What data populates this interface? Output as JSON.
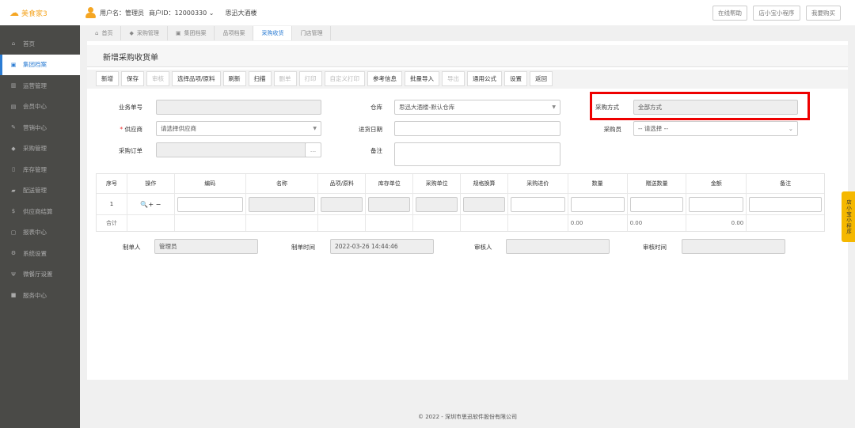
{
  "app": {
    "logo": "美食家3",
    "user_label": "用户名：管理员",
    "merchant_label": "商户ID：12000330",
    "store": "思迅大酒楼"
  },
  "top_buttons": [
    "在线帮助",
    "店小宝小程序",
    "我要购买"
  ],
  "sidebar": {
    "items": [
      {
        "label": "首页",
        "icon": "home-icon",
        "glyph": "⌂"
      },
      {
        "label": "集团档案",
        "icon": "file-icon",
        "glyph": "▣"
      },
      {
        "label": "运营管理",
        "icon": "chart-icon",
        "glyph": "▥"
      },
      {
        "label": "会员中心",
        "icon": "card-icon",
        "glyph": "▤"
      },
      {
        "label": "营销中心",
        "icon": "edit-icon",
        "glyph": "✎"
      },
      {
        "label": "采购管理",
        "icon": "cart-icon",
        "glyph": "◆"
      },
      {
        "label": "库存管理",
        "icon": "doc-icon",
        "glyph": "▯"
      },
      {
        "label": "配送管理",
        "icon": "truck-icon",
        "glyph": "▰"
      },
      {
        "label": "供应商结算",
        "icon": "dollar-icon",
        "glyph": "$"
      },
      {
        "label": "报表中心",
        "icon": "report-icon",
        "glyph": "▢"
      },
      {
        "label": "系统设置",
        "icon": "gears-icon",
        "glyph": "⚙"
      },
      {
        "label": "微餐厅设置",
        "icon": "fork-icon",
        "glyph": "Ψ"
      },
      {
        "label": "服务中心",
        "icon": "service-icon",
        "glyph": "■"
      }
    ],
    "active": 1
  },
  "tabs": [
    {
      "label": "首页",
      "glyph": "⌂"
    },
    {
      "label": "采购管理",
      "glyph": "◆"
    },
    {
      "label": "集团档案",
      "glyph": "▣"
    },
    {
      "label": "品项档案",
      "glyph": ""
    },
    {
      "label": "采购收货",
      "glyph": ""
    },
    {
      "label": "门店管理",
      "glyph": ""
    }
  ],
  "page_title": "新增采购收货单",
  "toolbar": [
    {
      "label": "新增",
      "enabled": true
    },
    {
      "label": "保存",
      "enabled": true
    },
    {
      "label": "审核",
      "enabled": false
    },
    {
      "label": "选择品项/原料",
      "enabled": true
    },
    {
      "label": "刷新",
      "enabled": true
    },
    {
      "label": "扫描",
      "enabled": true
    },
    {
      "label": "删单",
      "enabled": false
    },
    {
      "label": "打印",
      "enabled": false
    },
    {
      "label": "自定义打印",
      "enabled": false
    },
    {
      "label": "参考信息",
      "enabled": true
    },
    {
      "label": "批量导入",
      "enabled": true
    },
    {
      "label": "导出",
      "enabled": false
    },
    {
      "label": "通用公式",
      "enabled": true
    },
    {
      "label": "设置",
      "enabled": true
    },
    {
      "label": "返回",
      "enabled": true
    }
  ],
  "form": {
    "biz_no_label": "业务单号",
    "biz_no": "",
    "warehouse_label": "仓库",
    "warehouse": "思迅大酒楼-默认仓库",
    "method_label": "采购方式",
    "method": "全部方式",
    "supplier_label": "供应商",
    "supplier_placeholder": "请选择供应商",
    "date_label": "进货日期",
    "date": "",
    "buyer_label": "采购员",
    "buyer": "-- 请选择 --",
    "order_label": "采购订单",
    "order_btn": "...",
    "remark_label": "备注"
  },
  "table": {
    "headers": [
      "序号",
      "操作",
      "编码",
      "名称",
      "品项/原料",
      "库存单位",
      "采购单位",
      "规格换算",
      "采购进价",
      "数量",
      "赠送数量",
      "金额",
      "备注"
    ],
    "rows": [
      {
        "index": "1",
        "ops": "🔍+ −"
      }
    ],
    "total": {
      "label": "合计",
      "qty": "0.00",
      "gift_qty": "0.00",
      "amount": "0.00"
    }
  },
  "footer": {
    "maker_label": "制单人",
    "maker": "管理员",
    "make_time_label": "制单时间",
    "make_time": "2022-03-26 14:44:46",
    "auditor_label": "审核人",
    "audit_time_label": "审核时间"
  },
  "copyright": "© 2022 - 深圳市思迅软件股份有限公司",
  "float_tab": "店小宝小程序",
  "colors": {
    "accent": "#2b7cd3",
    "brand": "#f5a623",
    "highlight": "#e00000",
    "sidebar": "#4a4a47"
  }
}
